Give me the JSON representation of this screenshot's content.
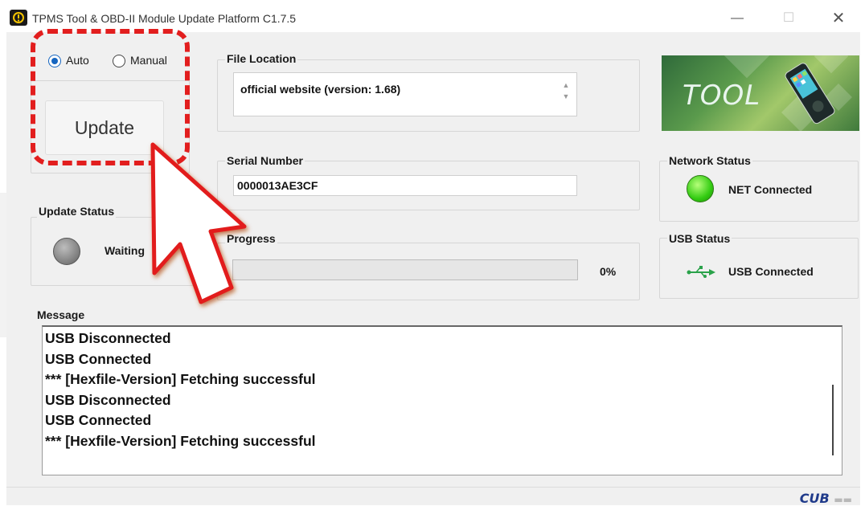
{
  "window": {
    "title": "TPMS Tool & OBD-II Module Update Platform C1.7.5",
    "minimize": "—",
    "maximize": "☐",
    "close": "✕"
  },
  "mode": {
    "options": [
      "Auto",
      "Manual"
    ],
    "selected": "Auto"
  },
  "update_button": {
    "label": "Update"
  },
  "file_location": {
    "label": "File Location",
    "value": "official website (version: 1.68)"
  },
  "serial_number": {
    "label": "Serial Number",
    "value": "0000013AE3CF"
  },
  "update_status": {
    "label": "Update Status",
    "text": "Waiting"
  },
  "progress": {
    "label": "Progress",
    "value": 0,
    "text": "0%"
  },
  "banner": {
    "text": "TOOL"
  },
  "network_status": {
    "label": "Network Status",
    "text": "NET Connected",
    "indicator_color": "#33cc12"
  },
  "usb_status": {
    "label": "USB Status",
    "text": "USB Connected",
    "icon": "usb-icon"
  },
  "message": {
    "label": "Message",
    "lines": [
      "USB Disconnected",
      "USB Connected",
      "*** [Hexfile-Version] Fetching successful",
      "USB Disconnected",
      "USB Connected",
      "*** [Hexfile-Version] Fetching successful"
    ]
  },
  "brand": {
    "text": "CUB",
    "suffix": "▬▬"
  },
  "annotation": {
    "color": "#e21e1e"
  }
}
